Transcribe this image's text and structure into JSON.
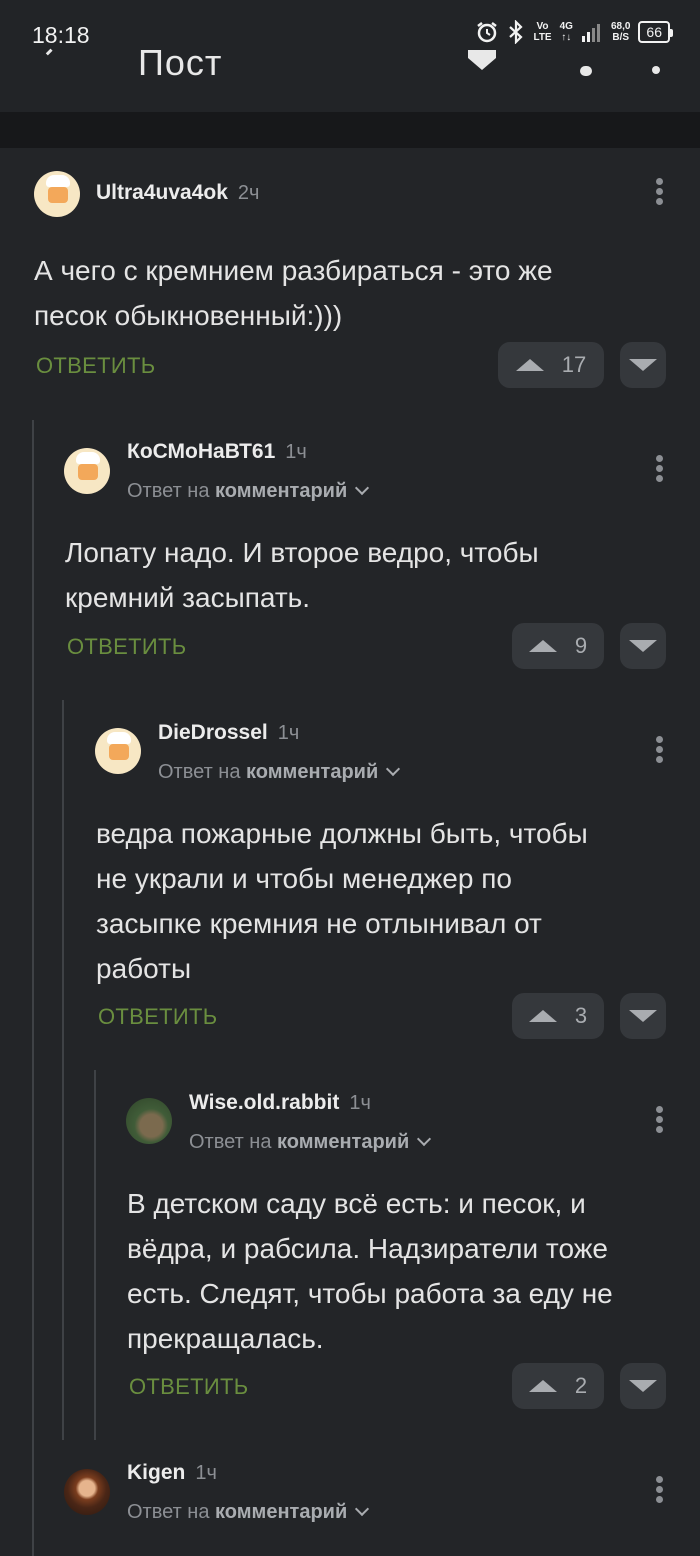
{
  "status_bar": {
    "time": "18:18",
    "network_top": "Vo",
    "network_bottom": "LTE",
    "signal_label": "4G",
    "speed_top": "68,0",
    "speed_bottom": "B/S",
    "battery": "66"
  },
  "header": {
    "title_peek": "Пост"
  },
  "comments": [
    {
      "username": "Ultra4uva4ok",
      "time": "2ч",
      "reply_prefix": "",
      "reply_target": "",
      "text_lines": [
        "А чего с кремнием разбираться - это же",
        "песок обыкновенный:)))"
      ],
      "reply_label": "ОТВЕТИТЬ",
      "votes": "17"
    },
    {
      "username": "КоСМоНаВТ61",
      "time": "1ч",
      "reply_prefix": "Ответ на ",
      "reply_target": "комментарий",
      "text_lines": [
        "Лопату надо. И второе ведро, чтобы",
        "кремний засыпать."
      ],
      "reply_label": "ОТВЕТИТЬ",
      "votes": "9"
    },
    {
      "username": "DieDrossel",
      "time": "1ч",
      "reply_prefix": "Ответ на ",
      "reply_target": "комментарий",
      "text_lines": [
        "ведра пожарные должны быть, чтобы",
        "не украли и чтобы менеджер по",
        "засыпке кремния не отлынивал от",
        "работы"
      ],
      "reply_label": "ОТВЕТИТЬ",
      "votes": "3"
    },
    {
      "username": "Wise.old.rabbit",
      "time": "1ч",
      "reply_prefix": "Ответ на ",
      "reply_target": "комментарий",
      "text_lines": [
        "В детском саду всё есть: и песок, и",
        "вёдра, и рабсила. Надзиратели тоже",
        "есть. Следят, чтобы работа за еду не",
        "прекращалась."
      ],
      "reply_label": "ОТВЕТИТЬ",
      "votes": "2"
    },
    {
      "username": "Kigen",
      "time": "1ч",
      "reply_prefix": "Ответ на ",
      "reply_target": "комментарий"
    }
  ]
}
